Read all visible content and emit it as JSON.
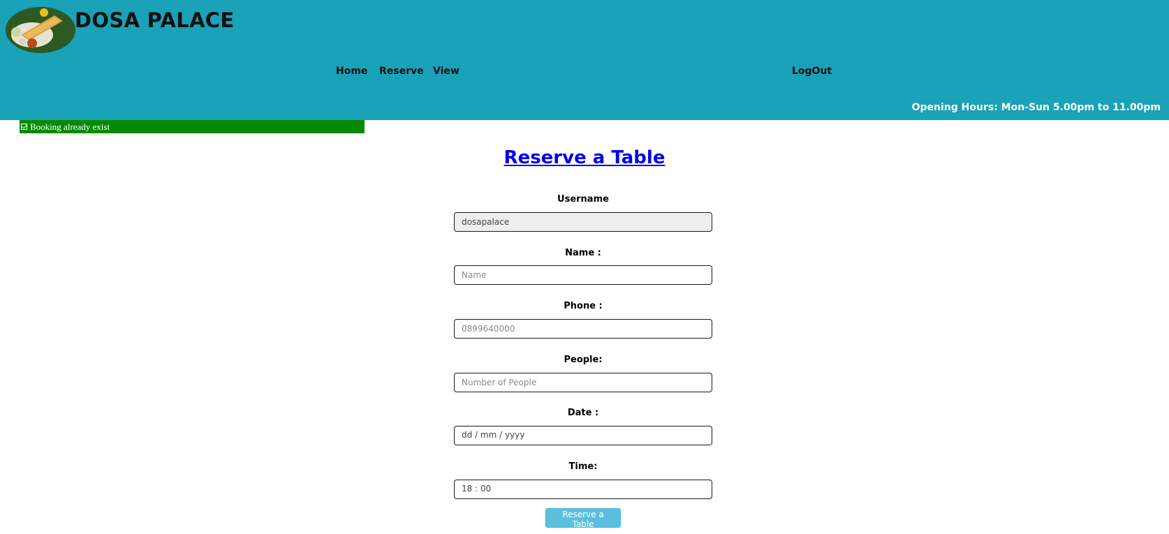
{
  "brand": {
    "name": "DOSA PALACE",
    "logo_icon": "dosa-plate-logo"
  },
  "nav": {
    "home": "Home",
    "reserve": "Reserve",
    "view": "View",
    "logout": "LogOut"
  },
  "header": {
    "opening_hours": "Opening Hours: Mon-Sun 5.00pm to 11.00pm",
    "bg_color": "#19a2b8"
  },
  "alert": {
    "icon": "check-square-icon",
    "message": "Booking already exist",
    "color": "#078a07"
  },
  "form": {
    "title": "Reserve a Table",
    "username_label": "Username",
    "username_value": "dosapalace",
    "name_label": "Name :",
    "name_placeholder": "Name",
    "phone_label": "Phone :",
    "phone_placeholder": "0899640000",
    "people_label": "People:",
    "people_placeholder": "Number of People",
    "date_label": "Date :",
    "date_value": "dd / mm / yyyy",
    "time_label": "Time:",
    "time_value": "18 : 00",
    "submit_label": "Reserve a Table",
    "submit_color": "#5bc0de"
  }
}
